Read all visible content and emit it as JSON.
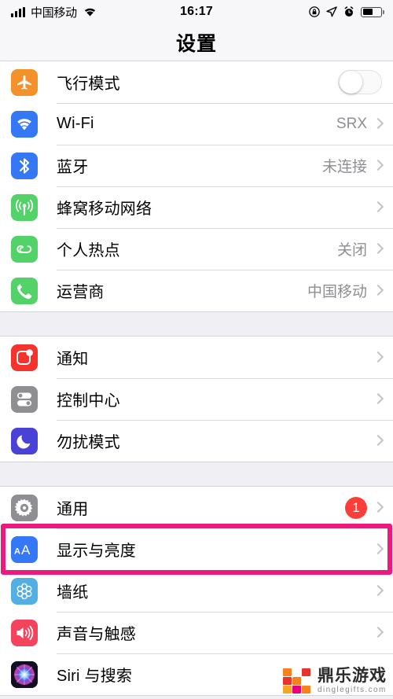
{
  "status_bar": {
    "carrier": "中国移动",
    "time": "16:17",
    "icons": {
      "signal": "signal-bars-icon",
      "wifi": "wifi-icon",
      "rotation_lock": "rotation-lock-icon",
      "location": "location-arrow-icon",
      "alarm": "alarm-clock-icon",
      "battery": "battery-icon"
    },
    "battery_level_pct": 55
  },
  "nav": {
    "title": "设置"
  },
  "colors": {
    "highlight": "#ec1a7f",
    "badge_red": "#fc3d39",
    "value_gray": "#8e8e93",
    "page_bg": "#efeff4",
    "row_bg": "#ffffff",
    "icon_airplane": "#f3912a",
    "icon_wifi": "#3478f6",
    "icon_bluetooth": "#3478f6",
    "icon_cellular": "#53d269",
    "icon_hotspot": "#53d269",
    "icon_carrier": "#53d269",
    "icon_notifications": "#f4332e",
    "icon_control_center": "#8e8e93",
    "icon_dnd": "#4a42d6",
    "icon_general": "#8e8e93",
    "icon_display": "#3478f6",
    "icon_wallpaper": "#53aee4",
    "icon_sounds": "#f4435c"
  },
  "groups": [
    {
      "name": "connectivity",
      "rows": [
        {
          "id": "airplane-mode",
          "icon": "airplane-icon",
          "label": "飞行模式",
          "accessory": "toggle",
          "toggle_on": false
        },
        {
          "id": "wifi",
          "icon": "wifi-icon",
          "label": "Wi-Fi",
          "accessory": "chevron",
          "value": "SRX"
        },
        {
          "id": "bluetooth",
          "icon": "bluetooth-icon",
          "label": "蓝牙",
          "accessory": "chevron",
          "value": "未连接"
        },
        {
          "id": "cellular",
          "icon": "cellular-icon",
          "label": "蜂窝移动网络",
          "accessory": "chevron",
          "value": ""
        },
        {
          "id": "hotspot",
          "icon": "hotspot-icon",
          "label": "个人热点",
          "accessory": "chevron",
          "value": "关闭"
        },
        {
          "id": "carrier",
          "icon": "phone-icon",
          "label": "运营商",
          "accessory": "chevron",
          "value": "中国移动"
        }
      ]
    },
    {
      "name": "notifications",
      "rows": [
        {
          "id": "notifications",
          "icon": "notification-icon",
          "label": "通知",
          "accessory": "chevron",
          "value": ""
        },
        {
          "id": "control-center",
          "icon": "control-center-icon",
          "label": "控制中心",
          "accessory": "chevron",
          "value": ""
        },
        {
          "id": "do-not-disturb",
          "icon": "moon-icon",
          "label": "勿扰模式",
          "accessory": "chevron",
          "value": ""
        }
      ]
    },
    {
      "name": "system",
      "rows": [
        {
          "id": "general",
          "icon": "gear-icon",
          "label": "通用",
          "accessory": "badge-chevron",
          "badge": "1"
        },
        {
          "id": "display",
          "icon": "aa-icon",
          "label": "显示与亮度",
          "accessory": "chevron",
          "value": "",
          "highlighted": true
        },
        {
          "id": "wallpaper",
          "icon": "wallpaper-icon",
          "label": "墙纸",
          "accessory": "chevron",
          "value": ""
        },
        {
          "id": "sounds",
          "icon": "speaker-icon",
          "label": "声音与触感",
          "accessory": "chevron",
          "value": ""
        },
        {
          "id": "siri",
          "icon": "siri-icon",
          "label": "Siri 与搜索",
          "accessory": "chevron",
          "value": ""
        }
      ]
    }
  ],
  "watermark": {
    "title": "鼎乐游戏",
    "domain": "dinglegifts.com"
  }
}
